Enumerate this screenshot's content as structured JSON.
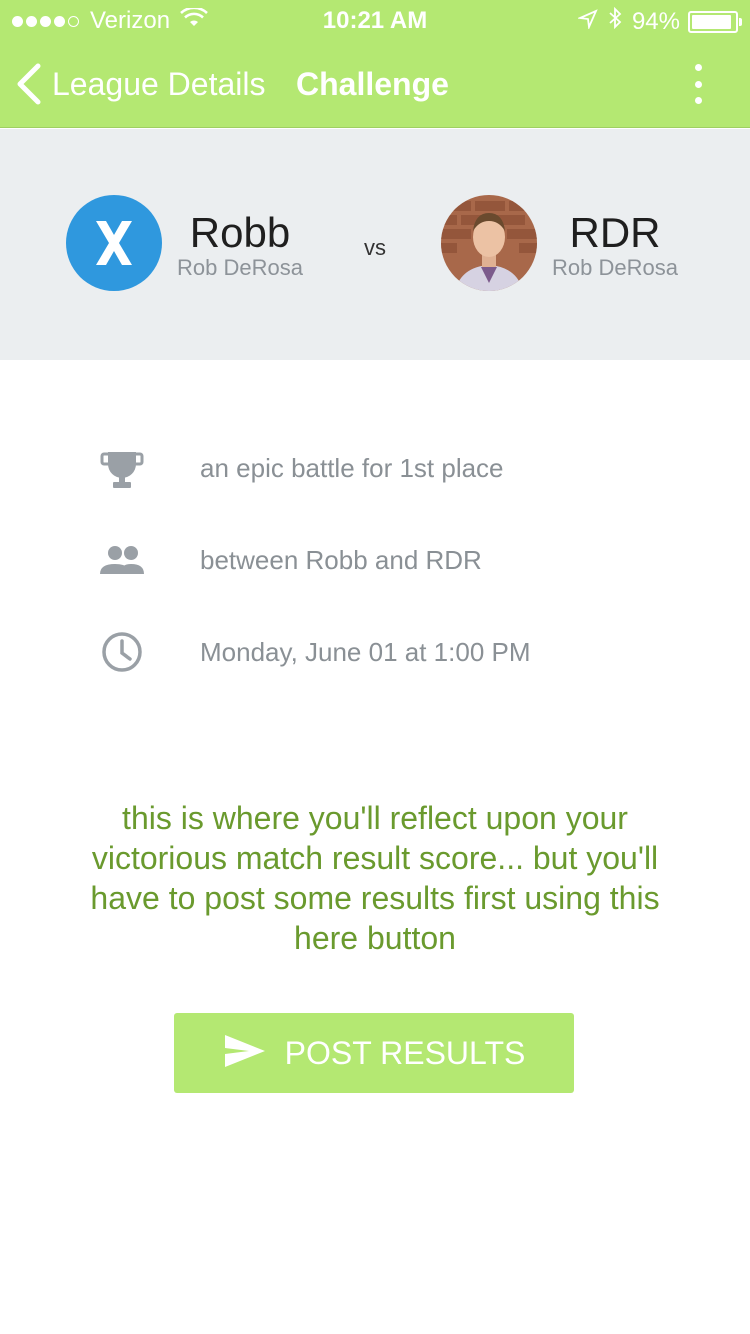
{
  "status_bar": {
    "carrier": "Verizon",
    "time": "10:21 AM",
    "battery": "94%",
    "battery_level": 0.94,
    "signal_dots_filled": 4,
    "signal_dots_total": 5
  },
  "nav": {
    "back_label": "League Details",
    "title": "Challenge"
  },
  "versus": {
    "player1": {
      "name": "Robb",
      "subtitle": "Rob DeRosa",
      "avatar_icon": "x-logo-icon"
    },
    "vs_label": "vs",
    "player2": {
      "name": "RDR",
      "subtitle": "Rob DeRosa",
      "avatar_icon": "profile-photo"
    }
  },
  "details": [
    {
      "icon": "trophy-icon",
      "text": "an epic battle for 1st place"
    },
    {
      "icon": "people-icon",
      "text": "between Robb and RDR"
    },
    {
      "icon": "clock-icon",
      "text": "Monday, June 01 at 1:00 PM"
    }
  ],
  "message": "this is where you'll reflect upon your victorious match result score... but you'll have to post some results first using this here button",
  "post_button": {
    "label": "POST RESULTS",
    "icon": "send-icon"
  },
  "colors": {
    "accent": "#b4e872",
    "message_text": "#6a9a2e",
    "panel_bg": "#ebeef0",
    "avatar_blue": "#2f98de",
    "muted_text": "#8a9095"
  }
}
